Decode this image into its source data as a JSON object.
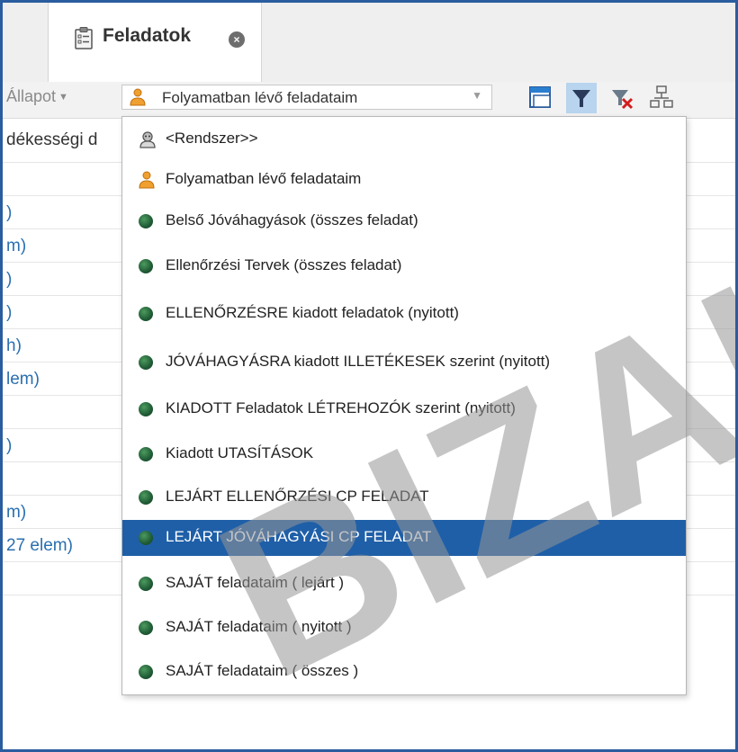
{
  "tab": {
    "title": "Feladatok",
    "icon": "clipboard-icon",
    "close_icon": "close-icon"
  },
  "toolbar": {
    "status_label": "Állapot",
    "filter_value": "Folyamatban lévő feladataim",
    "buttons": [
      "window-icon",
      "filter-icon",
      "clear-filter-icon",
      "hierarchy-icon"
    ]
  },
  "background": {
    "header": "dékességi d",
    "rows": [
      "",
      ")",
      "m)",
      ")",
      ")",
      "h)",
      "lem)",
      "",
      ")",
      "",
      "m)",
      "27 elem)",
      ""
    ]
  },
  "dropdown": {
    "selected_index": 10,
    "items": [
      {
        "label": "<Rendszer>>",
        "icon": "system-user-icon"
      },
      {
        "label": "Folyamatban lévő feladataim",
        "icon": "person-icon"
      },
      {
        "label": "Belső Jóváhagyások (összes feladat)",
        "icon": "globe-icon"
      },
      {
        "label": "Ellenőrzési Tervek (összes feladat)",
        "icon": "globe-icon"
      },
      {
        "label": "ELLENŐRZÉSRE kiadott feladatok (nyitott)",
        "icon": "globe-icon"
      },
      {
        "label": "JÓVÁHAGYÁSRA kiadott ILLETÉKESEK szerint (nyitott)",
        "icon": "globe-icon"
      },
      {
        "label": "KIADOTT Feladatok LÉTREHOZÓK szerint (nyitott)",
        "icon": "globe-icon"
      },
      {
        "label": "Kiadott UTASÍTÁSOK",
        "icon": "globe-icon"
      },
      {
        "label": "LEJÁRT ELLENŐRZÉSI CP FELADAT",
        "icon": "globe-icon"
      },
      {
        "label": "LEJÁRT JÓVÁHAGYÁSI CP FELADAT",
        "icon": "globe-icon"
      },
      {
        "label": "SAJÁT feladataim ( lejárt )",
        "icon": "globe-icon"
      },
      {
        "label": "SAJÁT feladataim ( nyitott )",
        "icon": "globe-icon"
      },
      {
        "label": "SAJÁT feladataim ( összes )",
        "icon": "globe-icon"
      }
    ]
  },
  "watermark": "BIZAL",
  "colors": {
    "selection": "#1f5fa8",
    "link": "#2a6fb0",
    "frame": "#2a5d9f",
    "person": "#f0a030",
    "globe": "#1f5b35"
  }
}
